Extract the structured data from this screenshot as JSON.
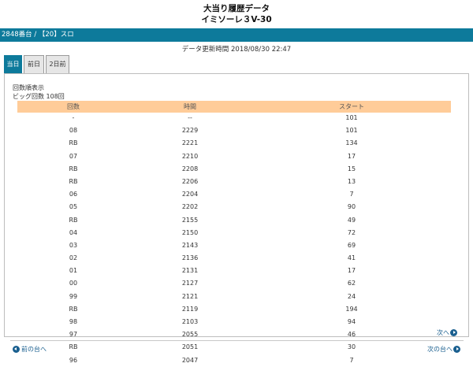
{
  "header": {
    "title": "大当り履歴データ",
    "model": "イミソーレ３V-30"
  },
  "machine_bar": {
    "label": "2848番台 / 【20】スロ"
  },
  "updated": {
    "text": "データ更新時間 2018/08/30 22:47"
  },
  "tabs": [
    {
      "label": "当日",
      "active": true
    },
    {
      "label": "前日",
      "active": false
    },
    {
      "label": "2日前",
      "active": false
    }
  ],
  "summary": {
    "display_label": "回数順表示",
    "big_count": "ビッグ回数 108回"
  },
  "table": {
    "headers": [
      "回数",
      "時間",
      "スタート"
    ],
    "rows": [
      [
        "-",
        "--",
        "101"
      ],
      [
        "08",
        "2229",
        "101"
      ],
      [
        "RB",
        "2221",
        "134"
      ],
      [
        "07",
        "2210",
        "17"
      ],
      [
        "RB",
        "2208",
        "15"
      ],
      [
        "RB",
        "2206",
        "13"
      ],
      [
        "06",
        "2204",
        "7"
      ],
      [
        "05",
        "2202",
        "90"
      ],
      [
        "RB",
        "2155",
        "49"
      ],
      [
        "04",
        "2150",
        "72"
      ],
      [
        "03",
        "2143",
        "69"
      ],
      [
        "02",
        "2136",
        "41"
      ],
      [
        "01",
        "2131",
        "17"
      ],
      [
        "00",
        "2127",
        "62"
      ],
      [
        "99",
        "2121",
        "24"
      ],
      [
        "RB",
        "2119",
        "194"
      ],
      [
        "98",
        "2103",
        "94"
      ],
      [
        "97",
        "2055",
        "46"
      ],
      [
        "RB",
        "2051",
        "30"
      ],
      [
        "96",
        "2047",
        "7"
      ]
    ]
  },
  "pagination": {
    "next": "次へ"
  },
  "footer": {
    "prev_machine": "前の台へ",
    "next_machine": "次の台へ"
  },
  "colors": {
    "accent": "#0d7a9b",
    "table_header": "#ffcc99",
    "link": "#1a5f8f"
  }
}
